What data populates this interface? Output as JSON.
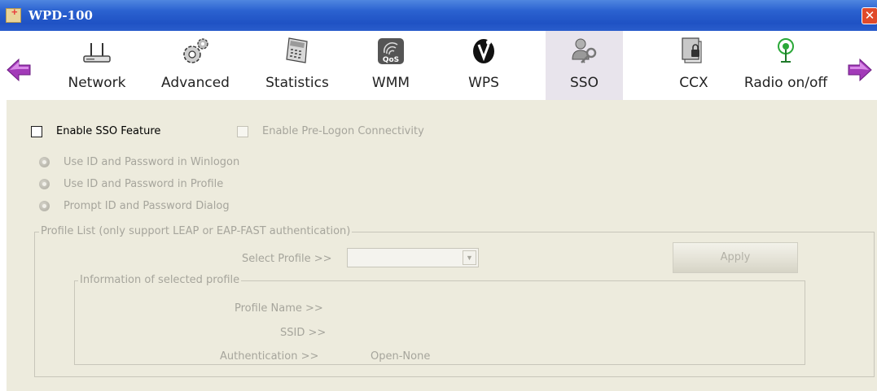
{
  "window": {
    "title": "WPD-100",
    "close_glyph": "✕"
  },
  "toolbar": {
    "left_arrow_icon": "arrow-left-icon",
    "right_arrow_icon": "arrow-right-icon",
    "items": [
      {
        "label": "Network",
        "icon": "router-icon"
      },
      {
        "label": "Advanced",
        "icon": "gears-icon"
      },
      {
        "label": "Statistics",
        "icon": "calculator-icon"
      },
      {
        "label": "WMM",
        "icon": "qos-icon",
        "icon_text": "QoS"
      },
      {
        "label": "WPS",
        "icon": "wps-icon"
      },
      {
        "label": "SSO",
        "icon": "user-key-icon",
        "active": true
      },
      {
        "label": "CCX",
        "icon": "ccx-icon"
      },
      {
        "label": "Radio on/off",
        "icon": "radio-signal-icon"
      }
    ]
  },
  "sso": {
    "enable_sso_label": "Enable SSO Feature",
    "enable_sso_checked": false,
    "pre_logon_label": "Enable Pre-Logon Connectivity",
    "pre_logon_checked": false,
    "options": [
      "Use ID and Password in Winlogon",
      "Use ID and Password in Profile",
      "Prompt ID and Password Dialog"
    ],
    "profile_list_legend": "Profile List (only support LEAP or EAP-FAST authentication)",
    "select_profile_label": "Select Profile >>",
    "select_profile_value": "",
    "apply_label": "Apply",
    "info_legend": "Information of selected profile",
    "profile_name_label": "Profile Name >>",
    "profile_name_value": "",
    "ssid_label": "SSID >>",
    "ssid_value": "",
    "authentication_label": "Authentication >>",
    "authentication_value": "Open-None"
  },
  "colors": {
    "titlebar": "#2b62d0",
    "panel_bg": "#edebdd",
    "disabled_text": "#a6a59c",
    "active_tab_bg": "#e8e4ec",
    "nav_arrow": "#a23ab8"
  }
}
